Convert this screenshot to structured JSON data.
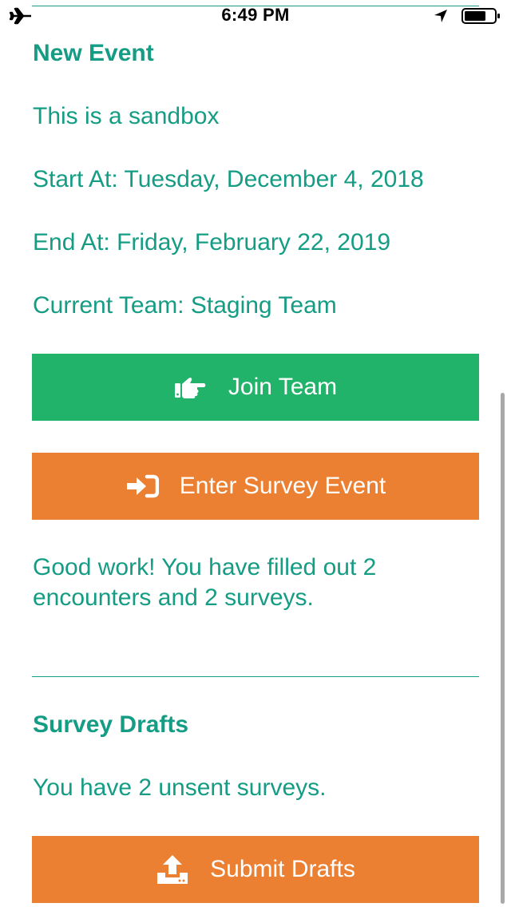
{
  "status_bar": {
    "time": "6:49 PM",
    "icons": [
      "airplane-icon",
      "location-arrow-icon",
      "battery-icon"
    ]
  },
  "event": {
    "title": "New Event",
    "description": "This is a sandbox",
    "start": "Start At: Tuesday, December 4, 2018",
    "end": "End At: Friday, February 22, 2019",
    "current_team": "Current Team: Staging Team"
  },
  "buttons": {
    "join_team": "Join Team",
    "enter_survey_event": "Enter Survey Event",
    "submit_drafts": "Submit Drafts"
  },
  "progress": {
    "message_line1": "Good work! You have filled out 2",
    "message_line2": "encounters and 2 surveys."
  },
  "drafts": {
    "title": "Survey Drafts",
    "message": "You have 2 unsent surveys."
  },
  "colors": {
    "text_teal": "#159c84",
    "join_green": "#22b36a",
    "action_orange": "#ec8032"
  },
  "icons": {
    "join_team": "hand-pointing-right-icon",
    "enter_survey_event": "sign-in-icon",
    "submit_drafts": "upload-icon"
  }
}
